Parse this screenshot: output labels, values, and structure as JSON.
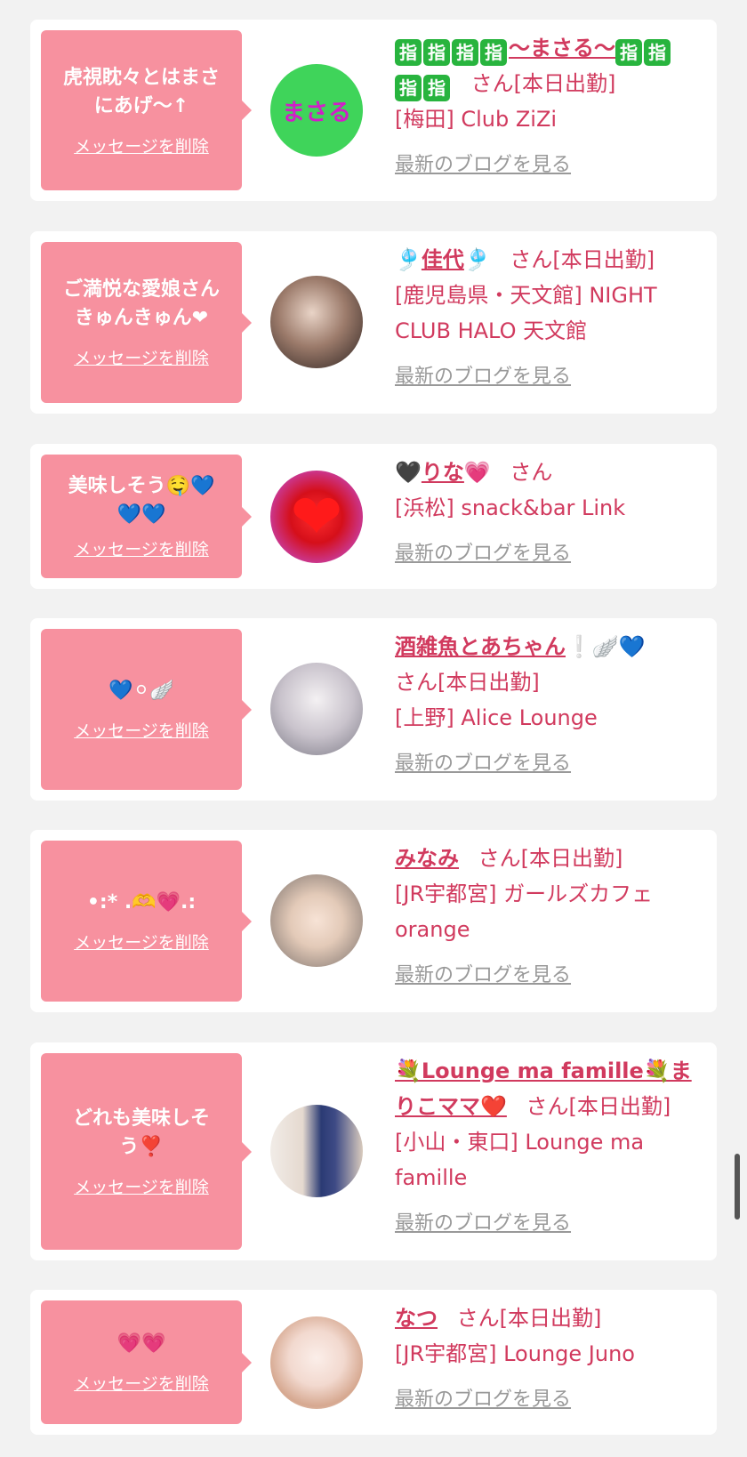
{
  "delete_label": "メッセージを削除",
  "blog_label": "最新のブログを見る",
  "colors": {
    "card_bg": "#ffffff",
    "bubble": "#f7919f",
    "accent": "#d13a5e",
    "link_gray": "#999999",
    "page_bg": "#f2f2f2"
  },
  "items": [
    {
      "message_lines": [
        "虎視眈々とはまさ",
        "にあげ〜↑"
      ],
      "avatar_text": "まさる",
      "name_prefix_icons": [
        "指",
        "指",
        "指",
        "指"
      ],
      "name": "〜まさる〜",
      "name_suffix_icons": [
        "指",
        "指",
        "指",
        "指"
      ],
      "san": "さん",
      "status": "[本日出勤]",
      "shop": "[梅田] Club ZiZi"
    },
    {
      "message_lines": [
        "ご満悦な愛娘さん",
        "きゅんきゅん❤"
      ],
      "name": "佳代",
      "name_deco": "🎐",
      "san": "さん",
      "status": "[本日出勤]",
      "shop": "[鹿児島県・天文館] NIGHT CLUB HALO 天文館"
    },
    {
      "message_lines": [
        "美味しそう🤤💙",
        "💙💙"
      ],
      "name": "りな",
      "name_deco_before": "🖤",
      "name_deco_after": "💗",
      "san": "さん",
      "status": "",
      "shop": "[浜松] snack&bar Link"
    },
    {
      "message_lines": [
        "💙⚪︎🪽"
      ],
      "name": "酒雑魚とあちゃん",
      "name_deco_after": "❕🪽💙",
      "san": "さん",
      "status": "[本日出勤]",
      "shop": "[上野] Alice Lounge"
    },
    {
      "message_lines": [
        "•:* .🫶💗.:"
      ],
      "name": "みなみ",
      "san": "さん",
      "status": "[本日出勤]",
      "shop": "[JR宇都宮] ガールズカフェ orange"
    },
    {
      "message_lines": [
        "どれも美味しそ",
        "う❣️"
      ],
      "name": "💐Lounge ma famille💐まりこママ❤️",
      "san": "さん",
      "status": "[本日出勤]",
      "shop": "[小山・東口] Lounge ma famille"
    },
    {
      "message_lines": [
        "💗💗"
      ],
      "name": "なつ",
      "san": "さん",
      "status": "[本日出勤]",
      "shop": "[JR宇都宮] Lounge Juno"
    }
  ]
}
